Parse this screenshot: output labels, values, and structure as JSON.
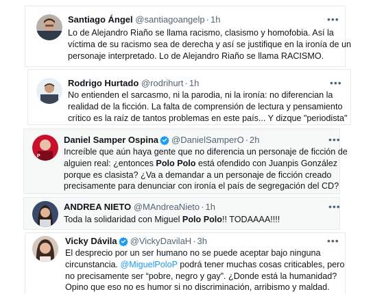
{
  "tweets": [
    {
      "name": "Santiago Ángel",
      "handle": "@santiagoangelp",
      "time": "1h",
      "verified": false,
      "lines": [
        [
          {
            "t": "Lo de Alejandro Riaño se llama racismo, clasismo y homofobia. Así la"
          }
        ],
        [
          {
            "t": "víctima de su racismo sea de derecha y así se justifique en la ironía de un"
          }
        ],
        [
          {
            "t": "personaje interpretado. Lo de Alejandro Riaño se llama RACISMO."
          }
        ]
      ]
    },
    {
      "name": "Rodrigo Hurtado",
      "handle": "@rodrihurt",
      "time": "1h",
      "verified": false,
      "lines": [
        [
          {
            "t": "No entienden el sarcasmo, ni la parodia, ni la ironía: no diferencian la"
          }
        ],
        [
          {
            "t": "realidad de la ficción. La falta de comprensión de lectura y pensamiento"
          }
        ],
        [
          {
            "t": "crítico es la raíz de tantos problemas en este país... Y dizque \"periodista\""
          }
        ]
      ]
    },
    {
      "name": "Daniel Samper Ospina",
      "handle": "@DanielSamperO",
      "time": "2h",
      "verified": true,
      "lines": [
        [
          {
            "t": "Increíble que aún haya gente que no diferencia un personaje de ficción de"
          }
        ],
        [
          {
            "t": "alguien real: ¿entonces "
          },
          {
            "t": "Polo Polo",
            "s": "b"
          },
          {
            "t": " está ofendido con Juanpis González"
          }
        ],
        [
          {
            "t": "porque es clasista? ¿Va a demandar a un personaje de ficción creado"
          }
        ],
        [
          {
            "t": "precisamente para denunciar con ironía el país de segregación del CD?"
          }
        ]
      ]
    },
    {
      "name": "ANDREA NIETO",
      "handle": "@MAndreaNieto",
      "time": "1h",
      "verified": false,
      "lines": [
        [
          {
            "t": "Toda la solidaridad con Miguel "
          },
          {
            "t": "Polo Polo",
            "s": "b"
          },
          {
            "t": "!! TODAAAA!!!!"
          }
        ]
      ]
    },
    {
      "name": "Vicky Dávila",
      "handle": "@VickyDavilaH",
      "time": "3h",
      "verified": true,
      "lines": [
        [
          {
            "t": "El desprecio por un ser humano no se puede aceptar bajo ninguna"
          }
        ],
        [
          {
            "t": "circunstancia. "
          },
          {
            "t": "@MiguelPoloP",
            "s": "m"
          },
          {
            "t": " podrá tener muchas cosas criticables, pero"
          }
        ],
        [
          {
            "t": "no precisamente ser “pobre, negro y gay”. ¿Donde está la humanidad?"
          }
        ],
        [
          {
            "t": "Opino que eso no es humor si no discriminación, arribismo y maldad."
          }
        ]
      ]
    }
  ],
  "more_icon": "more-horizontal-icon",
  "colors": {
    "accent": "#1d9bf0",
    "muted": "#536471",
    "text": "#0f1419"
  }
}
